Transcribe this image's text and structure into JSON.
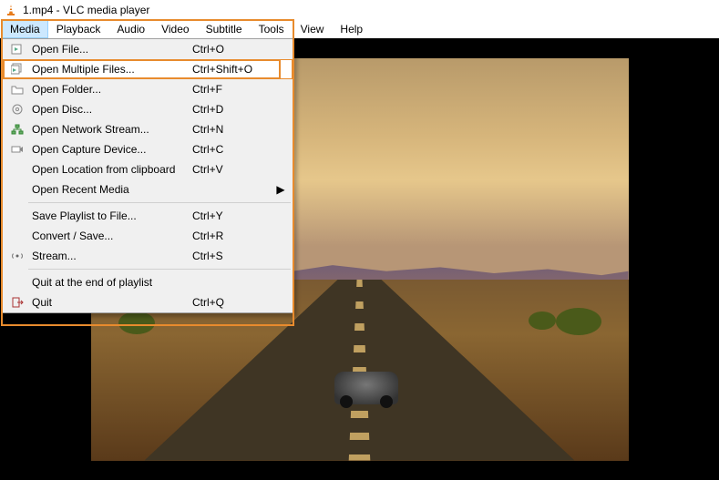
{
  "titlebar": {
    "title": "1.mp4 - VLC media player"
  },
  "menubar": {
    "items": [
      "Media",
      "Playback",
      "Audio",
      "Video",
      "Subtitle",
      "Tools",
      "View",
      "Help"
    ],
    "active_index": 0
  },
  "media_menu": {
    "groups": [
      [
        {
          "icon": "file-open-icon",
          "label": "Open File...",
          "shortcut": "Ctrl+O",
          "highlight": false
        },
        {
          "icon": "file-open-multi-icon",
          "label": "Open Multiple Files...",
          "shortcut": "Ctrl+Shift+O",
          "highlight": true
        },
        {
          "icon": "folder-open-icon",
          "label": "Open Folder...",
          "shortcut": "Ctrl+F",
          "highlight": false
        },
        {
          "icon": "disc-icon",
          "label": "Open Disc...",
          "shortcut": "Ctrl+D",
          "highlight": false
        },
        {
          "icon": "network-icon",
          "label": "Open Network Stream...",
          "shortcut": "Ctrl+N",
          "highlight": false
        },
        {
          "icon": "capture-icon",
          "label": "Open Capture Device...",
          "shortcut": "Ctrl+C",
          "highlight": false
        },
        {
          "icon": "",
          "label": "Open Location from clipboard",
          "shortcut": "Ctrl+V",
          "highlight": false
        },
        {
          "icon": "",
          "label": "Open Recent Media",
          "shortcut": "",
          "submenu": true,
          "highlight": false
        }
      ],
      [
        {
          "icon": "",
          "label": "Save Playlist to File...",
          "shortcut": "Ctrl+Y",
          "highlight": false
        },
        {
          "icon": "",
          "label": "Convert / Save...",
          "shortcut": "Ctrl+R",
          "highlight": false
        },
        {
          "icon": "stream-icon",
          "label": "Stream...",
          "shortcut": "Ctrl+S",
          "highlight": false
        }
      ],
      [
        {
          "icon": "",
          "label": "Quit at the end of playlist",
          "shortcut": "",
          "highlight": false
        },
        {
          "icon": "quit-icon",
          "label": "Quit",
          "shortcut": "Ctrl+Q",
          "highlight": false
        }
      ]
    ]
  }
}
